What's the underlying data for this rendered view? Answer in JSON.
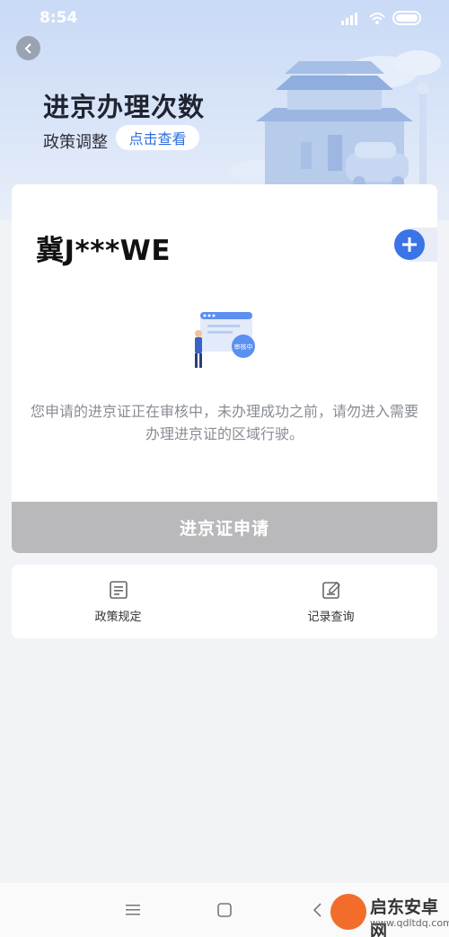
{
  "status_bar": {
    "time": "8:54"
  },
  "header": {
    "title": "进京办理次数",
    "policy_label": "政策调整",
    "policy_link": "点击查看"
  },
  "card": {
    "plate": "冀J***WE",
    "review_badge": "审核中",
    "notice": "您申请的进京证正在审核中，未办理成功之前，请勿进入需要办理进京证的区域行驶。",
    "apply_button": "进京证申请"
  },
  "menu": {
    "items": [
      {
        "label": "政策规定",
        "icon": "document-icon"
      },
      {
        "label": "记录查询",
        "icon": "edit-record-icon"
      }
    ]
  },
  "watermark": {
    "name": "启东安卓网",
    "url": "www.qdltdq.com"
  },
  "colors": {
    "accent": "#3a74e6",
    "disabled_button": "#b9b9bb",
    "hero_bg": "#d9e5f8"
  }
}
